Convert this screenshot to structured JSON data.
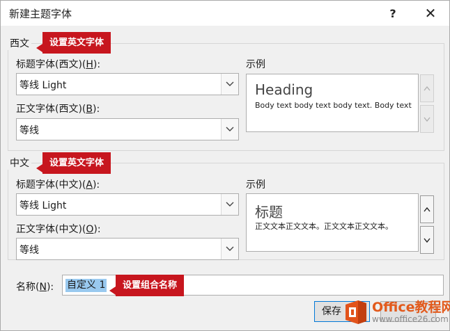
{
  "window": {
    "title": "新建主题字体",
    "help_label": "?",
    "close_label": "✕"
  },
  "western": {
    "group_label": "西文",
    "heading_font_label_prefix": "标题字体(西文)(",
    "heading_font_label_key": "H",
    "heading_font_label_suffix": "):",
    "heading_font_value": "等线 Light",
    "body_font_label_prefix": "正文字体(西文)(",
    "body_font_label_key": "B",
    "body_font_label_suffix": "):",
    "body_font_value": "等线",
    "preview_label": "示例",
    "preview_heading": "Heading",
    "preview_body": "Body text body text body text. Body text"
  },
  "chinese": {
    "group_label": "中文",
    "heading_font_label_prefix": "标题字体(中文)(",
    "heading_font_label_key": "A",
    "heading_font_label_suffix": "):",
    "heading_font_value": "等线 Light",
    "body_font_label_prefix": "正文字体(中文)(",
    "body_font_label_key": "O",
    "body_font_label_suffix": "):",
    "body_font_value": "等线",
    "preview_label": "示例",
    "preview_heading": "标题",
    "preview_body": "正文文本正文文本。正文文本正文文本。"
  },
  "name": {
    "label_prefix": "名称(",
    "label_key": "N",
    "label_suffix": "):",
    "value": "自定义 1"
  },
  "buttons": {
    "save_label": "保存"
  },
  "callouts": {
    "western": "设置英文字体",
    "chinese": "设置英文字体",
    "name": "设置组合名称"
  },
  "watermark": {
    "line1": "Office教程网",
    "line2": "www.office26.com"
  }
}
